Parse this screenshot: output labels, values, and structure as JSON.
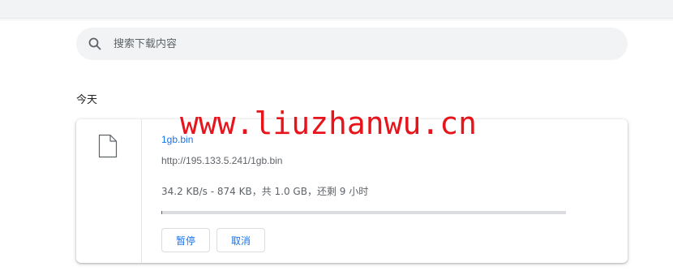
{
  "search": {
    "placeholder": "搜索下载内容"
  },
  "date_group": "今天",
  "download": {
    "file_name": "1gb.bin",
    "url": "http://195.133.5.241/1gb.bin",
    "status": "34.2 KB/s - 874 KB，共 1.0 GB，还剩 9 小时",
    "progress_fraction": 0.0008,
    "pause_label": "暂停",
    "cancel_label": "取消"
  },
  "watermark": "www.liuzhanwu.cn",
  "colors": {
    "accent": "#1a73e8",
    "watermark": "#e8141c"
  },
  "icons": {
    "search": "search-icon",
    "file": "file-icon"
  }
}
